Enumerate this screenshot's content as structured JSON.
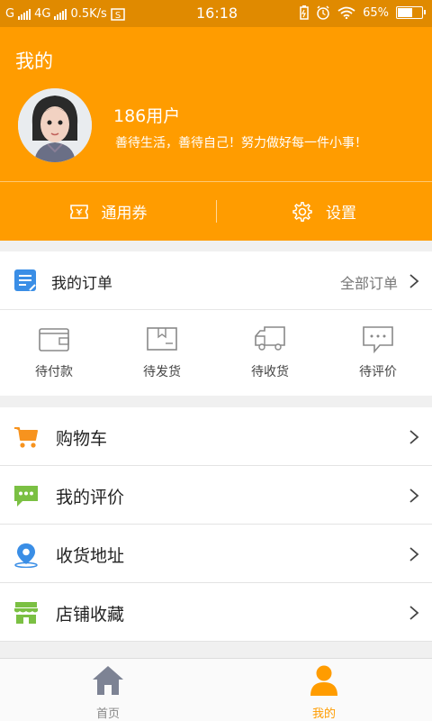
{
  "status_bar": {
    "carrier1": "G",
    "carrier2": "4G",
    "speed": "0.5K/s",
    "time": "16:18",
    "battery": "65%",
    "battery_level": 0.65
  },
  "header": {
    "title": "我的",
    "username": "186用户",
    "motto": "善待生活，善待自己！努力做好每一件小事！",
    "coupon_label": "通用券",
    "settings_label": "设置"
  },
  "orders": {
    "title": "我的订单",
    "all_label": "全部订单",
    "statuses": [
      {
        "label": "待付款",
        "icon": "wallet-icon"
      },
      {
        "label": "待发货",
        "icon": "package-icon"
      },
      {
        "label": "待收货",
        "icon": "truck-icon"
      },
      {
        "label": "待评价",
        "icon": "comment-icon"
      }
    ]
  },
  "menu": {
    "items": [
      {
        "label": "购物车",
        "icon": "cart-icon",
        "color": "#f7931e"
      },
      {
        "label": "我的评价",
        "icon": "chat-icon",
        "color": "#7bc043"
      },
      {
        "label": "收货地址",
        "icon": "location-icon",
        "color": "#3a8ee6"
      },
      {
        "label": "店铺收藏",
        "icon": "store-icon",
        "color": "#7bc043"
      }
    ]
  },
  "tabbar": {
    "tabs": [
      {
        "label": "首页",
        "icon": "home-icon",
        "active": false
      },
      {
        "label": "我的",
        "icon": "user-icon",
        "active": true
      }
    ]
  },
  "colors": {
    "brand": "#ff9c00",
    "status_bar": "#e08a00"
  }
}
